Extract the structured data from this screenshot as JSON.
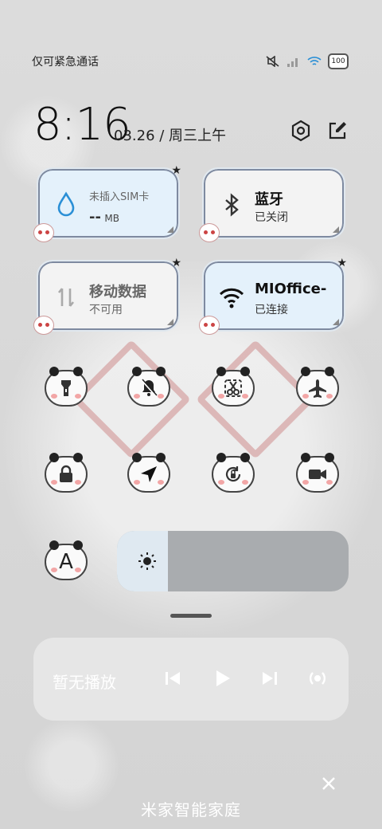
{
  "status": {
    "carrier": "仅可紧急通话",
    "battery": "100"
  },
  "clock": {
    "time": "8:16",
    "date": "03.26 / 周三上午"
  },
  "tiles": {
    "data": {
      "title": "未插入SIM卡",
      "value": "--",
      "unit": "MB"
    },
    "bluetooth": {
      "title": "蓝牙",
      "status": "已关闭"
    },
    "mobile": {
      "title": "移动数据",
      "status": "不可用"
    },
    "wifi": {
      "title": "MIOffice-",
      "status": "已连接"
    }
  },
  "toggles": [
    {
      "icon": "flashlight-icon"
    },
    {
      "icon": "silent-bell-icon"
    },
    {
      "icon": "screenshot-scissors-icon"
    },
    {
      "icon": "airplane-icon"
    },
    {
      "icon": "lock-icon"
    },
    {
      "icon": "location-icon"
    },
    {
      "icon": "rotation-lock-icon"
    },
    {
      "icon": "video-camera-icon"
    },
    {
      "icon": "font-icon",
      "label": "A"
    }
  ],
  "brightness": {
    "level": 0.22
  },
  "media": {
    "label": "暂无播放"
  },
  "footer": {
    "title": "米家智能家庭"
  },
  "colors": {
    "tile_active_bg": "#e4f1fb",
    "accent": "#2a8fd6"
  }
}
